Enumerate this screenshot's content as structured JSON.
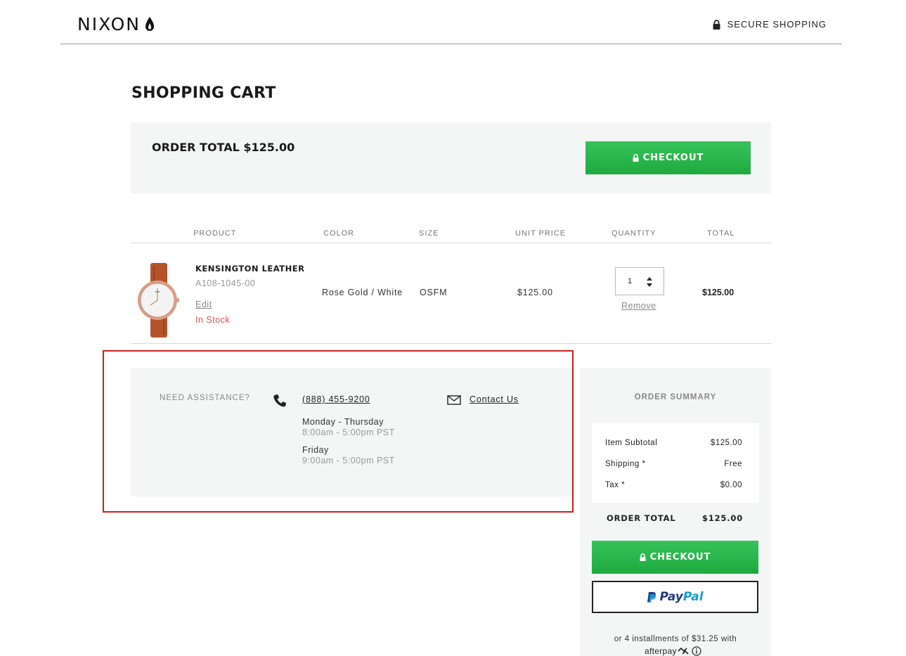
{
  "header": {
    "logo_text": "NIXON",
    "secure_label": "SECURE SHOPPING"
  },
  "page": {
    "title": "SHOPPING CART"
  },
  "order_total_bar": {
    "label": "ORDER TOTAL $125.00",
    "checkout_label": "CHECKOUT"
  },
  "table": {
    "headers": [
      "PRODUCT",
      "COLOR",
      "SIZE",
      "UNIT PRICE",
      "QUANTITY",
      "TOTAL"
    ],
    "rows": [
      {
        "name": "KENSINGTON LEATHER",
        "sku": "A108-1045-00",
        "edit_label": "Edit",
        "stock": "In Stock",
        "color": "Rose Gold / White",
        "size": "OSFM",
        "unit_price": "$125.00",
        "quantity": "1",
        "remove_label": "Remove",
        "total": "$125.00"
      }
    ]
  },
  "assistance": {
    "title": "NEED ASSISTANCE?",
    "phone": "(888) 455-9200",
    "hours": [
      {
        "day": "Monday - Thursday",
        "time": "8:00am - 5:00pm PST"
      },
      {
        "day": "Friday",
        "time": "9:00am - 5:00pm PST"
      }
    ],
    "contact_label": "Contact Us"
  },
  "summary": {
    "title": "ORDER SUMMARY",
    "rows": [
      {
        "label": "Item Subtotal",
        "value": "$125.00"
      },
      {
        "label": "Shipping *",
        "value": "Free"
      },
      {
        "label": "Tax *",
        "value": "$0.00"
      }
    ],
    "total_label": "ORDER TOTAL",
    "total_value": "$125.00",
    "checkout_label": "CHECKOUT",
    "paypal_a": "Pay",
    "paypal_b": "Pal",
    "installments": "or 4 installments of $31.25 with",
    "afterpay_text": "afterpay"
  },
  "colors": {
    "checkout_green": "#2bb84d",
    "stock_red": "#d9534f",
    "highlight_red": "#cc1f1f",
    "panel_gray": "#f4f5f5"
  },
  "icons": [
    "nixon-logo-icon",
    "lock-icon",
    "phone-icon",
    "mail-icon",
    "paypal-icon",
    "afterpay-icon",
    "info-icon",
    "quantity-spinner-icon"
  ]
}
